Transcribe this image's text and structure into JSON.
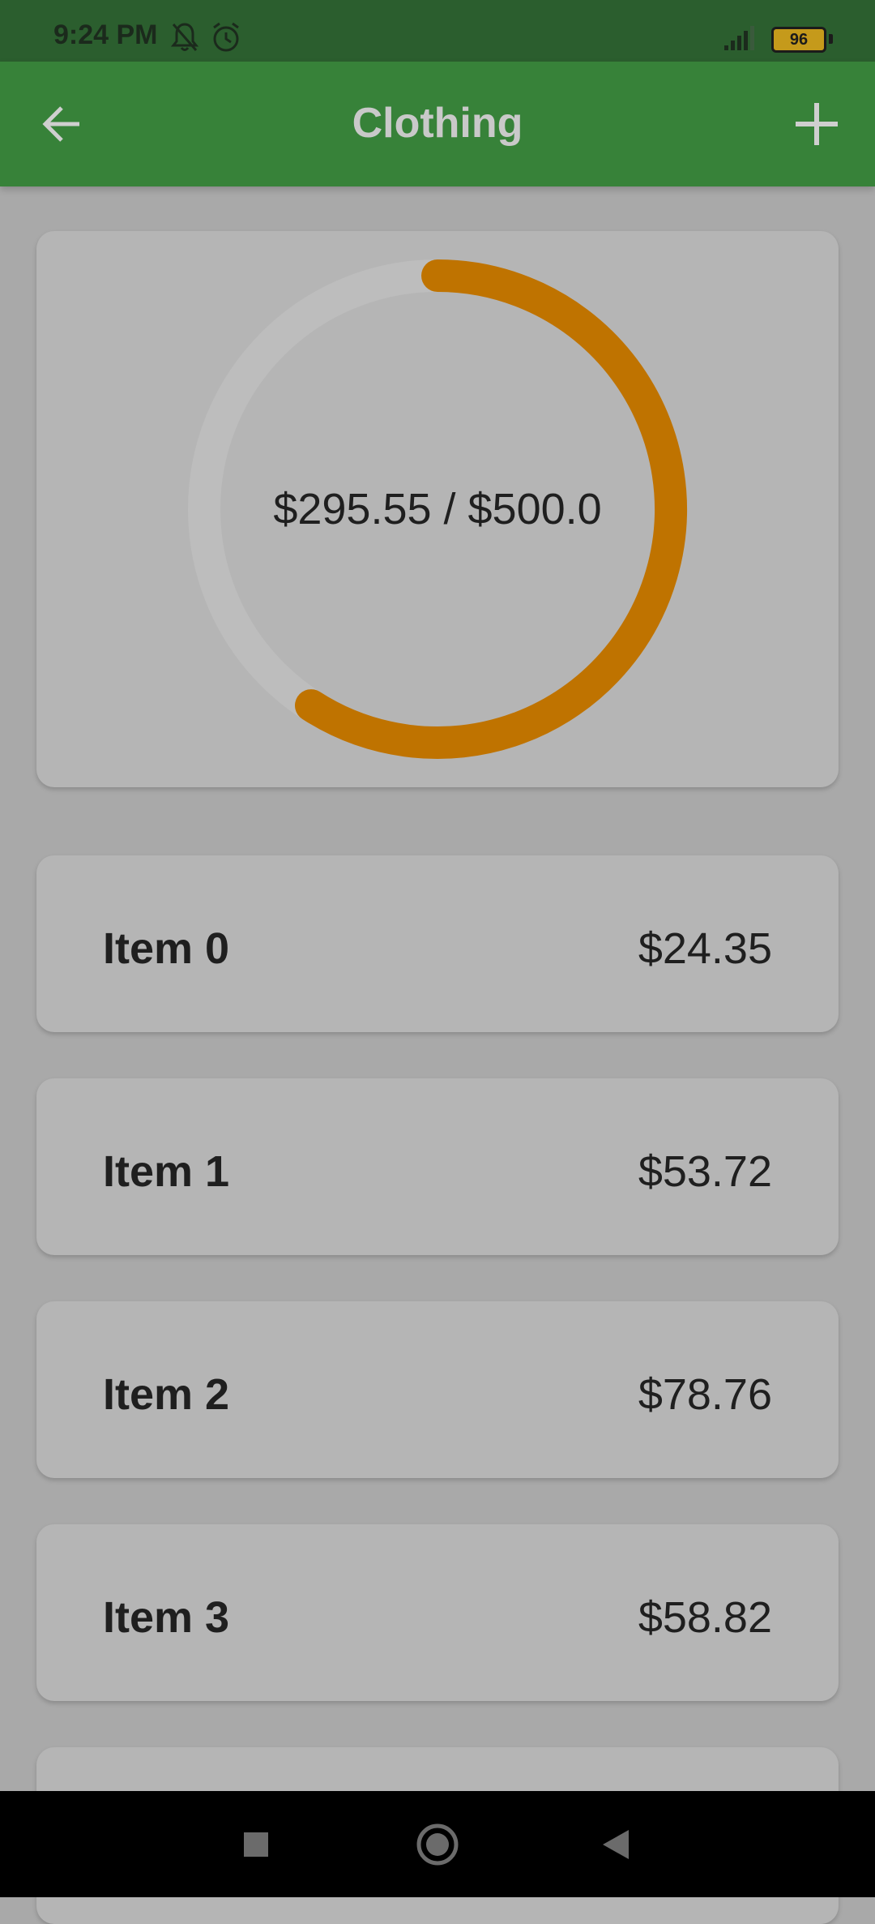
{
  "status_bar": {
    "time": "9:24 PM",
    "battery": "96",
    "icons": [
      "bell-off-icon",
      "alarm-icon",
      "signal-icon",
      "battery-icon"
    ]
  },
  "app_bar": {
    "title": "Clothing",
    "back_icon": "arrow-left-icon",
    "add_icon": "plus-icon"
  },
  "budget": {
    "label": "$295.55 / $500.0",
    "spent": 295.55,
    "limit": 500.0,
    "progress_fraction": 0.5911,
    "progress_color": "#bf7300",
    "track_color": "#bdbdbd"
  },
  "items": [
    {
      "name": "Item 0",
      "price": "$24.35"
    },
    {
      "name": "Item 1",
      "price": "$53.72"
    },
    {
      "name": "Item 2",
      "price": "$78.76"
    },
    {
      "name": "Item 3",
      "price": "$58.82"
    }
  ],
  "colors": {
    "app_bar": "#378239",
    "status_bar": "#2b5e2e",
    "background": "#a9a9a9",
    "card": "#b5b5b5"
  },
  "nav_bar": {
    "icons": [
      "square-recents-icon",
      "circle-home-icon",
      "triangle-back-icon"
    ]
  }
}
